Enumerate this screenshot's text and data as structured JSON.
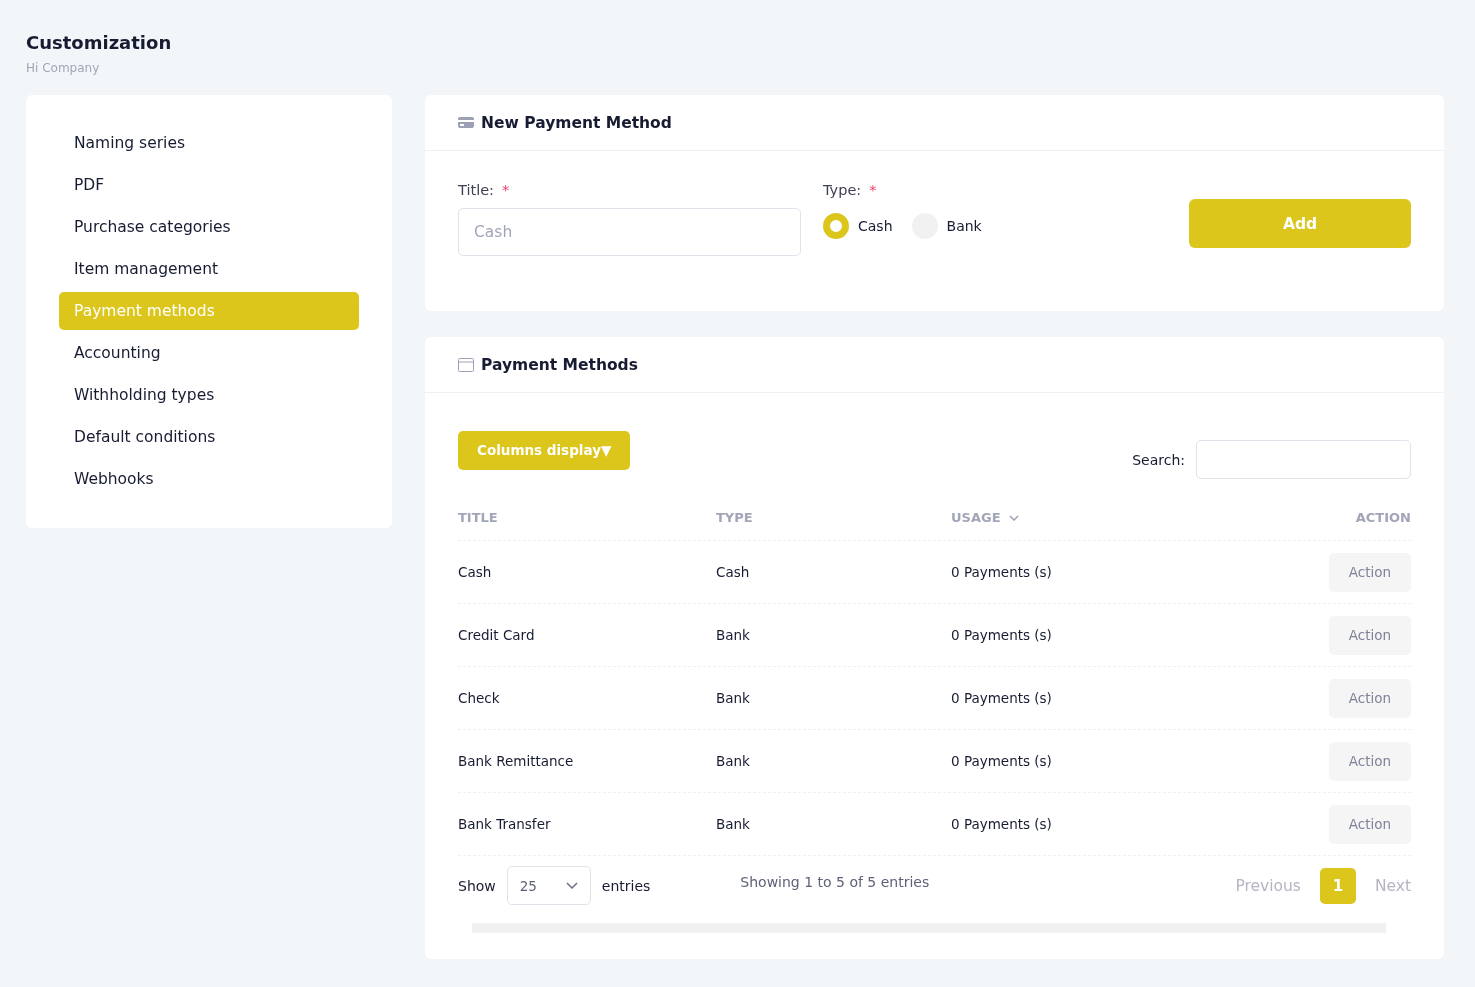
{
  "page": {
    "title": "Customization",
    "subtitle": "Hi Company"
  },
  "sidebar": {
    "items": [
      {
        "label": "Naming series",
        "selected": false
      },
      {
        "label": "PDF",
        "selected": false
      },
      {
        "label": "Purchase categories",
        "selected": false
      },
      {
        "label": "Item management",
        "selected": false
      },
      {
        "label": "Payment methods",
        "selected": true
      },
      {
        "label": "Accounting",
        "selected": false
      },
      {
        "label": "Withholding types",
        "selected": false
      },
      {
        "label": "Default conditions",
        "selected": false
      },
      {
        "label": "Webhooks",
        "selected": false
      }
    ]
  },
  "new_method": {
    "title": "New Payment Method",
    "title_field": {
      "label": "Title:",
      "required_mark": "*",
      "placeholder": "Cash"
    },
    "type_field": {
      "label": "Type:",
      "required_mark": "*",
      "options": [
        {
          "label": "Cash",
          "selected": true
        },
        {
          "label": "Bank",
          "selected": false
        }
      ]
    },
    "add_button": "Add"
  },
  "methods": {
    "title": "Payment Methods",
    "columns_button": "Columns display▼",
    "search_label": "Search:",
    "table": {
      "columns": [
        {
          "label": "TITLE",
          "sortable": false
        },
        {
          "label": "TYPE",
          "sortable": false
        },
        {
          "label": "USAGE",
          "sortable": true
        },
        {
          "label": "ACTION",
          "sortable": false
        }
      ],
      "rows": [
        {
          "title": "Cash",
          "type": "Cash",
          "usage": "0 Payments (s)",
          "action": "Action"
        },
        {
          "title": "Credit Card",
          "type": "Bank",
          "usage": "0 Payments (s)",
          "action": "Action"
        },
        {
          "title": "Check",
          "type": "Bank",
          "usage": "0 Payments (s)",
          "action": "Action"
        },
        {
          "title": "Bank Remittance",
          "type": "Bank",
          "usage": "0 Payments (s)",
          "action": "Action"
        },
        {
          "title": "Bank Transfer",
          "type": "Bank",
          "usage": "0 Payments (s)",
          "action": "Action"
        }
      ]
    },
    "footer": {
      "show_label": "Show",
      "page_size": "25",
      "entries_label": "entries",
      "info": "Showing 1 to 5 of 5 entries",
      "pagination": {
        "previous": "Previous",
        "pages": [
          {
            "label": "1",
            "selected": true
          }
        ],
        "next": "Next"
      }
    }
  }
}
